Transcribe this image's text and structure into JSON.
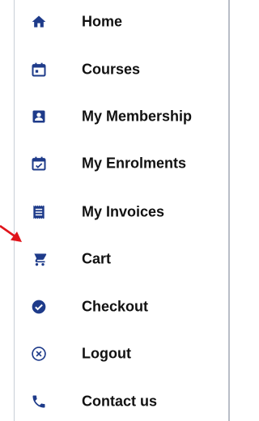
{
  "colors": {
    "icon": "#1e3b8a",
    "text": "#111111",
    "arrow": "#e0141b"
  },
  "nav": {
    "items": [
      {
        "label": "Home",
        "icon": "home-icon"
      },
      {
        "label": "Courses",
        "icon": "calendar-icon"
      },
      {
        "label": "My Membership",
        "icon": "account-box-icon"
      },
      {
        "label": "My Enrolments",
        "icon": "calendar-check-icon"
      },
      {
        "label": "My Invoices",
        "icon": "receipt-icon"
      },
      {
        "label": "Cart",
        "icon": "cart-icon"
      },
      {
        "label": "Checkout",
        "icon": "check-circle-icon"
      },
      {
        "label": "Logout",
        "icon": "close-circle-icon"
      },
      {
        "label": "Contact us",
        "icon": "phone-icon"
      }
    ]
  },
  "annotation": {
    "icon": "red-arrow-icon",
    "points_to": "Cart"
  }
}
